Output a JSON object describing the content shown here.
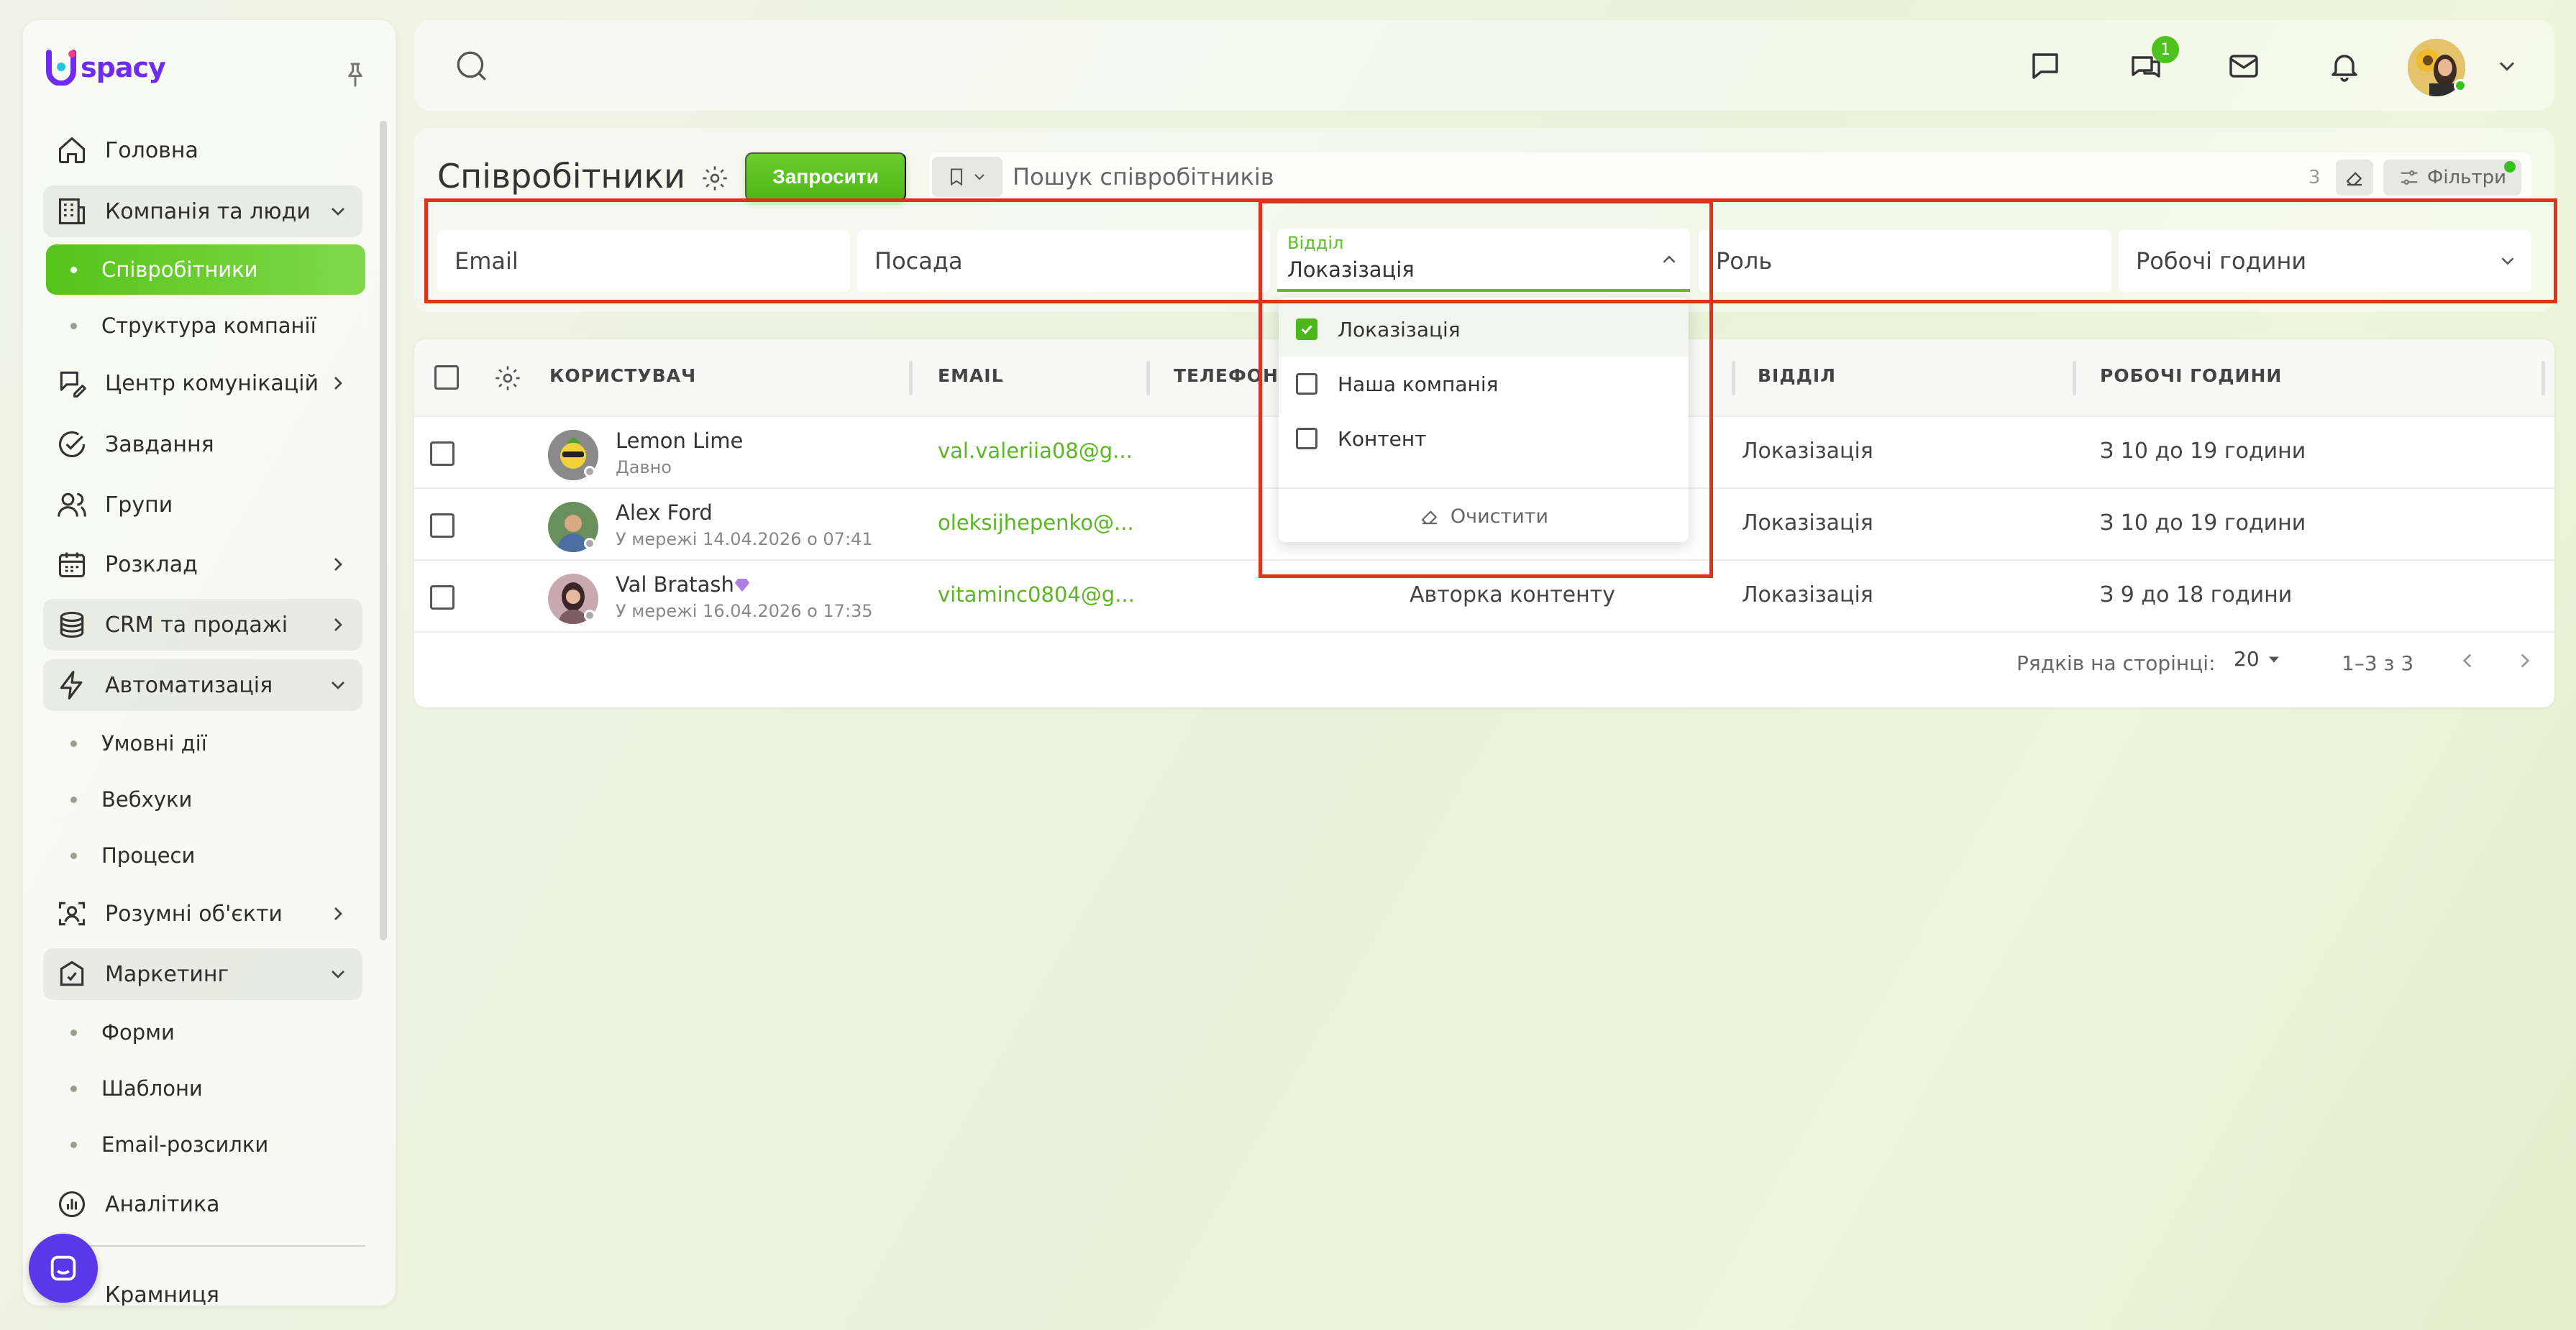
{
  "app": {
    "logo_text": "spacy",
    "brand_color": "#6d2cf0",
    "accent_color": "#56c41b"
  },
  "sidebar": {
    "items": [
      {
        "label": "Головна",
        "icon": "home-icon"
      },
      {
        "label": "Компанія та люди",
        "icon": "building-icon",
        "expanded": true
      },
      {
        "label": "Співробітники",
        "sub": true,
        "active": true
      },
      {
        "label": "Структура компанії",
        "sub": true
      },
      {
        "label": "Центр комунікацій",
        "icon": "chat-pen-icon"
      },
      {
        "label": "Завдання",
        "icon": "check-circle-icon"
      },
      {
        "label": "Групи",
        "icon": "users-icon"
      },
      {
        "label": "Розклад",
        "icon": "calendar-icon"
      },
      {
        "label": "CRM та продажі",
        "icon": "coins-icon"
      },
      {
        "label": "Автоматизація",
        "icon": "lightning-icon",
        "expanded": true
      },
      {
        "label": "Умовні дії",
        "sub": true
      },
      {
        "label": "Вебхуки",
        "sub": true
      },
      {
        "label": "Процеси",
        "sub": true
      },
      {
        "label": "Розумні об'єкти",
        "icon": "smart-object-icon"
      },
      {
        "label": "Маркетинг",
        "icon": "marketing-icon",
        "expanded": true
      },
      {
        "label": "Форми",
        "sub": true
      },
      {
        "label": "Шаблони",
        "sub": true
      },
      {
        "label": "Email-розсилки",
        "sub": true
      },
      {
        "label": "Аналітика",
        "icon": "analytics-icon"
      },
      {
        "label": "Крамниця",
        "icon": "store-icon"
      }
    ]
  },
  "topbar": {
    "chat_badge": "1"
  },
  "page": {
    "title": "Співробітники",
    "invite_label": "Запросити",
    "search_placeholder": "Пошук співробітників",
    "count": "3",
    "filters_label": "Фільтри"
  },
  "filters": {
    "email": "Email",
    "position": "Посада",
    "dept_label": "Відділ",
    "dept_value": "Локазізація",
    "role": "Роль",
    "hours": "Робочі години",
    "dropdown": {
      "options": [
        {
          "label": "Локазізація",
          "checked": true
        },
        {
          "label": "Наша компанія",
          "checked": false
        },
        {
          "label": "Контент",
          "checked": false
        }
      ],
      "clear_label": "Очистити"
    }
  },
  "table": {
    "headers": {
      "user": "КОРИСТУВАЧ",
      "email": "EMAIL",
      "phone": "ТЕЛЕФОН",
      "dept": "ВІДДІЛ",
      "hours": "РОБОЧІ ГОДИНИ"
    },
    "rows": [
      {
        "name": "Lemon Lime",
        "status": "Давно",
        "email": "val.valeriia08@g...",
        "position": "",
        "dept": "Локазізація",
        "hours": "З 10 до 19 години"
      },
      {
        "name": "Alex Ford",
        "status": "У мережі 14.04.2026 о 07:41",
        "email": "oleksijhepenko@...",
        "position": "",
        "dept": "Локазізація",
        "hours": "З 10 до 19 години"
      },
      {
        "name": "Val Bratash",
        "status": "У мережі 16.04.2026 о 17:35",
        "email": "vitaminc0804@g...",
        "position": "Авторка контенту",
        "dept": "Локазізація",
        "hours": "З 9 до 18 години"
      }
    ],
    "pager": {
      "rows_label": "Рядків на сторінці:",
      "rows_value": "20",
      "range": "1–3 з 3"
    }
  }
}
